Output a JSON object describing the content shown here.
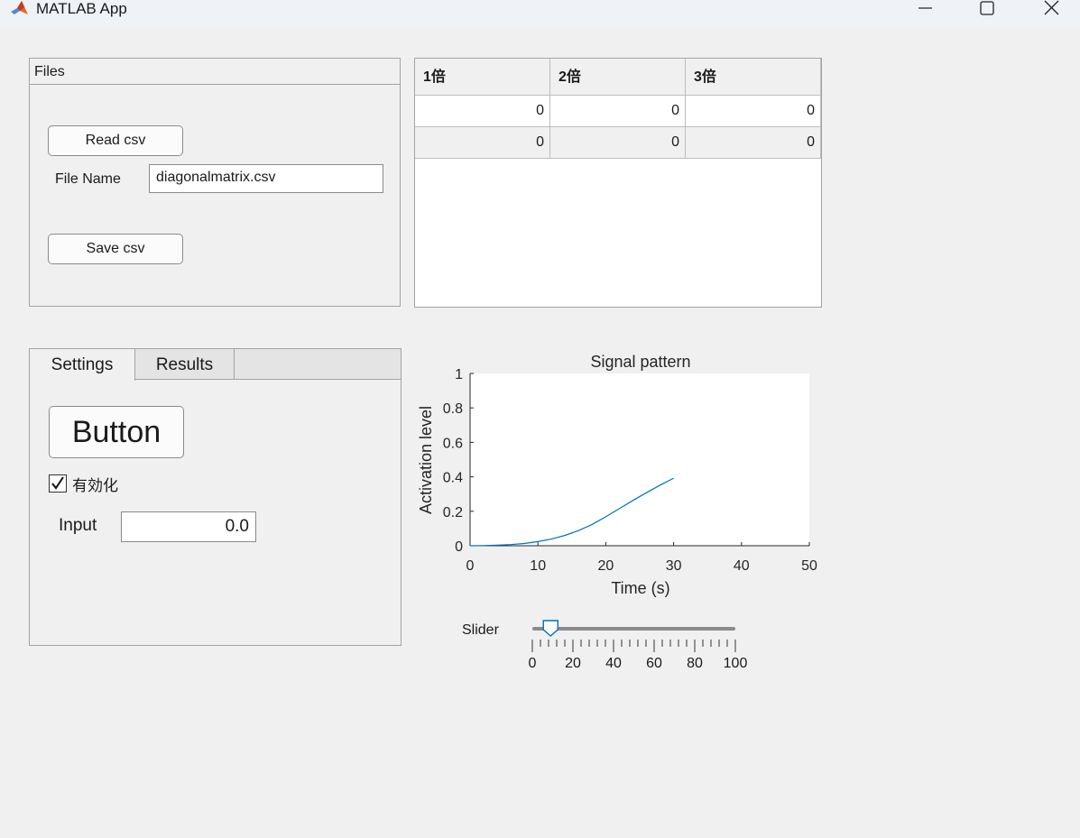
{
  "window": {
    "title": "MATLAB App"
  },
  "files_panel": {
    "title": "Files",
    "read_button": "Read csv",
    "file_name_label": "File Name",
    "file_name_value": "diagonalmatrix.csv",
    "save_button": "Save csv"
  },
  "table": {
    "columns": [
      "1倍",
      "2倍",
      "3倍"
    ],
    "rows": [
      [
        "0",
        "0",
        "0"
      ],
      [
        "0",
        "0",
        "0"
      ]
    ]
  },
  "tabs": {
    "items": [
      {
        "label": "Settings",
        "selected": true
      },
      {
        "label": "Results",
        "selected": false
      }
    ],
    "button_label": "Button",
    "checkbox": {
      "label": "有効化",
      "checked": true
    },
    "input_label": "Input",
    "input_value": "0.0"
  },
  "chart_data": {
    "type": "line",
    "title": "Signal pattern",
    "xlabel": "Time (s)",
    "ylabel": "Activation level",
    "xlim": [
      0,
      50
    ],
    "ylim": [
      0,
      1
    ],
    "xticks": [
      0,
      10,
      20,
      30,
      40,
      50
    ],
    "yticks": [
      0,
      0.2,
      0.4,
      0.6,
      0.8,
      1
    ],
    "ytick_labels": [
      "0",
      "0.2",
      "0.4",
      "0.6",
      "0.8",
      "1"
    ],
    "grid": false,
    "series": [
      {
        "color": "#0072bd",
        "x": [
          0,
          2,
          4,
          6,
          8,
          10,
          12,
          14,
          16,
          18,
          20,
          22,
          24,
          26,
          28,
          30
        ],
        "y": [
          0,
          0.001,
          0.003,
          0.007,
          0.013,
          0.024,
          0.039,
          0.06,
          0.088,
          0.124,
          0.168,
          0.215,
          0.263,
          0.308,
          0.352,
          0.392
        ]
      }
    ]
  },
  "slider": {
    "label": "Slider",
    "min": 0,
    "max": 100,
    "value": 9,
    "major_ticks": [
      0,
      20,
      40,
      60,
      80,
      100
    ],
    "tick_labels": [
      "0",
      "20",
      "40",
      "60",
      "80",
      "100"
    ],
    "minor_step": 4
  },
  "colors": {
    "accent": "#0072bd",
    "background": "#f0f0f0"
  }
}
